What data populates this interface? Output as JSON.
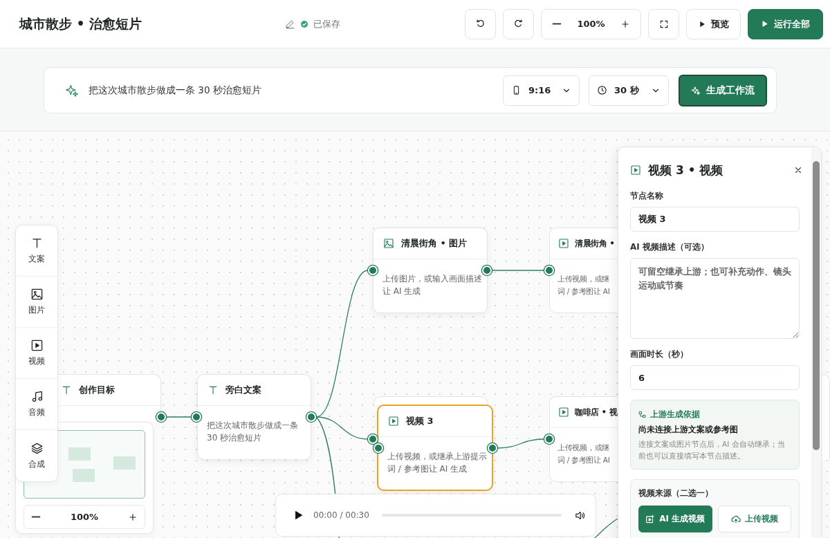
{
  "header": {
    "title": "城市散步 • 治愈短片",
    "save_status": "已保存",
    "zoom": "100%",
    "preview": "预览",
    "run_all": "运行全部"
  },
  "prompt_bar": {
    "prompt": "把这次城市散步做成一条 30 秒治愈短片",
    "ratio": "9:16",
    "duration": "30 秒",
    "generate": "生成工作流"
  },
  "toolbox": [
    {
      "kind": "text",
      "label": "文案"
    },
    {
      "kind": "image",
      "label": "图片"
    },
    {
      "kind": "video",
      "label": "视频"
    },
    {
      "kind": "audio",
      "label": "音频"
    },
    {
      "kind": "compose",
      "label": "合成"
    }
  ],
  "nodes": [
    {
      "kind": "text",
      "title": "创作目标",
      "selected": false
    },
    {
      "kind": "text",
      "title": "旁白文案",
      "lines": [
        "把这次城市散步做成一条",
        "30 秒治愈短片"
      ],
      "selected": false
    },
    {
      "kind": "image",
      "title": "清晨街角 • 图片",
      "lines": [
        "上传图片，或输入画面描述",
        "让 AI 生成"
      ],
      "selected": false
    },
    {
      "kind": "video",
      "title": "清晨街角 •",
      "lines": [
        "上传视频，或继",
        "词 / 参考图让 AI"
      ],
      "selected": false
    },
    {
      "kind": "video",
      "title": "视频 3",
      "lines": [
        "上传视频，或继承上游提示",
        "词 / 参考图让 AI 生成"
      ],
      "selected": true
    },
    {
      "kind": "video",
      "title": "咖啡店 • 视",
      "lines": [
        "上传视频，或继",
        "词 / 参考图让 AI"
      ],
      "selected": false
    }
  ],
  "minimap": {
    "zoom": "100%"
  },
  "player": {
    "time": "00:00 / 00:30",
    "level": 0
  },
  "inspector": {
    "kind": "video",
    "title": "视频 3 • 视频",
    "fields": [
      {
        "kind": "input",
        "label": "节点名称",
        "value": "视频 3"
      },
      {
        "kind": "textarea",
        "label": "AI 视频描述（可选）",
        "placeholder": "可留空继承上游；也可补充动作、镜头运动或节奏"
      },
      {
        "kind": "input",
        "label": "画面时长（秒）",
        "value": "6"
      }
    ],
    "upstream": {
      "title": "上游生成依据",
      "heading": "尚未连接上游文案或参考图",
      "note": "连接文案或图片节点后，AI 会自动继承；当前也可以直接填写本节点描述。"
    },
    "source": {
      "label": "视频来源（二选一）",
      "options": [
        {
          "kind": "ai",
          "label": "AI 生成视频",
          "selected": true
        },
        {
          "kind": "upload",
          "label": "上传视频",
          "selected": false
        }
      ]
    }
  }
}
